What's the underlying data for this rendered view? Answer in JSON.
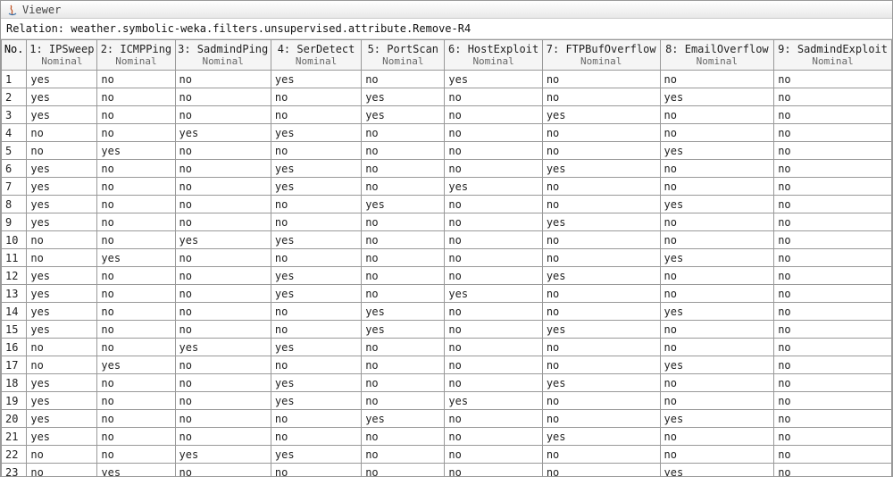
{
  "window": {
    "title": "Viewer"
  },
  "relation": {
    "label": "Relation:",
    "value": "weather.symbolic-weka.filters.unsupervised.attribute.Remove-R4"
  },
  "table": {
    "row_header": "No.",
    "columns": [
      {
        "idx": "1",
        "name": "IPSweep",
        "type": "Nominal"
      },
      {
        "idx": "2",
        "name": "ICMPPing",
        "type": "Nominal"
      },
      {
        "idx": "3",
        "name": "SadmindPing",
        "type": "Nominal"
      },
      {
        "idx": "4",
        "name": "SerDetect",
        "type": "Nominal"
      },
      {
        "idx": "5",
        "name": "PortScan",
        "type": "Nominal"
      },
      {
        "idx": "6",
        "name": "HostExploit",
        "type": "Nominal"
      },
      {
        "idx": "7",
        "name": "FTPBufOverflow",
        "type": "Nominal"
      },
      {
        "idx": "8",
        "name": "EmailOverflow",
        "type": "Nominal"
      },
      {
        "idx": "9",
        "name": "SadmindExploit",
        "type": "Nominal"
      }
    ],
    "rows": [
      {
        "no": "1",
        "c": [
          "yes",
          "no",
          "no",
          "yes",
          "no",
          "yes",
          "no",
          "no",
          "no"
        ]
      },
      {
        "no": "2",
        "c": [
          "yes",
          "no",
          "no",
          "no",
          "yes",
          "no",
          "no",
          "yes",
          "no"
        ]
      },
      {
        "no": "3",
        "c": [
          "yes",
          "no",
          "no",
          "no",
          "yes",
          "no",
          "yes",
          "no",
          "no"
        ]
      },
      {
        "no": "4",
        "c": [
          "no",
          "no",
          "yes",
          "yes",
          "no",
          "no",
          "no",
          "no",
          "no"
        ]
      },
      {
        "no": "5",
        "c": [
          "no",
          "yes",
          "no",
          "no",
          "no",
          "no",
          "no",
          "yes",
          "no"
        ]
      },
      {
        "no": "6",
        "c": [
          "yes",
          "no",
          "no",
          "yes",
          "no",
          "no",
          "yes",
          "no",
          "no"
        ]
      },
      {
        "no": "7",
        "c": [
          "yes",
          "no",
          "no",
          "yes",
          "no",
          "yes",
          "no",
          "no",
          "no"
        ]
      },
      {
        "no": "8",
        "c": [
          "yes",
          "no",
          "no",
          "no",
          "yes",
          "no",
          "no",
          "yes",
          "no"
        ]
      },
      {
        "no": "9",
        "c": [
          "yes",
          "no",
          "no",
          "no",
          "no",
          "no",
          "yes",
          "no",
          "no"
        ]
      },
      {
        "no": "10",
        "c": [
          "no",
          "no",
          "yes",
          "yes",
          "no",
          "no",
          "no",
          "no",
          "no"
        ]
      },
      {
        "no": "11",
        "c": [
          "no",
          "yes",
          "no",
          "no",
          "no",
          "no",
          "no",
          "yes",
          "no"
        ]
      },
      {
        "no": "12",
        "c": [
          "yes",
          "no",
          "no",
          "yes",
          "no",
          "no",
          "yes",
          "no",
          "no"
        ]
      },
      {
        "no": "13",
        "c": [
          "yes",
          "no",
          "no",
          "yes",
          "no",
          "yes",
          "no",
          "no",
          "no"
        ]
      },
      {
        "no": "14",
        "c": [
          "yes",
          "no",
          "no",
          "no",
          "yes",
          "no",
          "no",
          "yes",
          "no"
        ]
      },
      {
        "no": "15",
        "c": [
          "yes",
          "no",
          "no",
          "no",
          "yes",
          "no",
          "yes",
          "no",
          "no"
        ]
      },
      {
        "no": "16",
        "c": [
          "no",
          "no",
          "yes",
          "yes",
          "no",
          "no",
          "no",
          "no",
          "no"
        ]
      },
      {
        "no": "17",
        "c": [
          "no",
          "yes",
          "no",
          "no",
          "no",
          "no",
          "no",
          "yes",
          "no"
        ]
      },
      {
        "no": "18",
        "c": [
          "yes",
          "no",
          "no",
          "yes",
          "no",
          "no",
          "yes",
          "no",
          "no"
        ]
      },
      {
        "no": "19",
        "c": [
          "yes",
          "no",
          "no",
          "yes",
          "no",
          "yes",
          "no",
          "no",
          "no"
        ]
      },
      {
        "no": "20",
        "c": [
          "yes",
          "no",
          "no",
          "no",
          "yes",
          "no",
          "no",
          "yes",
          "no"
        ]
      },
      {
        "no": "21",
        "c": [
          "yes",
          "no",
          "no",
          "no",
          "no",
          "no",
          "yes",
          "no",
          "no"
        ]
      },
      {
        "no": "22",
        "c": [
          "no",
          "no",
          "yes",
          "yes",
          "no",
          "no",
          "no",
          "no",
          "no"
        ]
      },
      {
        "no": "23",
        "c": [
          "no",
          "yes",
          "no",
          "no",
          "no",
          "no",
          "no",
          "yes",
          "no"
        ]
      }
    ]
  }
}
